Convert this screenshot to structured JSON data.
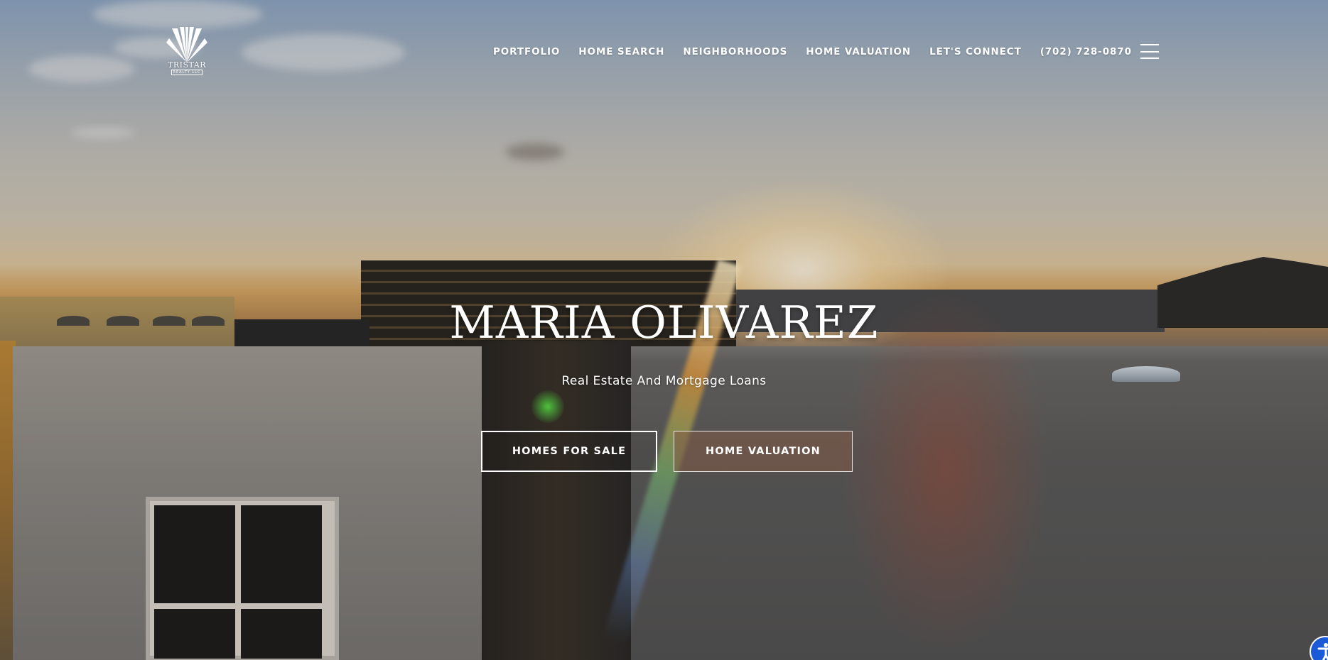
{
  "brand": {
    "logo_text": "TRISTAR",
    "logo_sub": "REALTY LLC"
  },
  "nav": {
    "items": [
      {
        "label": "PORTFOLIO"
      },
      {
        "label": "HOME SEARCH"
      },
      {
        "label": "NEIGHBORHOODS"
      },
      {
        "label": "HOME VALUATION"
      },
      {
        "label": "LET'S CONNECT"
      },
      {
        "label": "(702) 728-0870"
      }
    ],
    "menu_icon": "hamburger-menu-icon"
  },
  "hero": {
    "title": "MARIA OLIVAREZ",
    "subtitle": "Real Estate And Mortgage Loans",
    "buttons": {
      "homes_for_sale": "HOMES FOR SALE",
      "home_valuation": "HOME VALUATION"
    }
  },
  "accessibility": {
    "icon": "accessibility-icon",
    "color": "#1a5ad6"
  }
}
